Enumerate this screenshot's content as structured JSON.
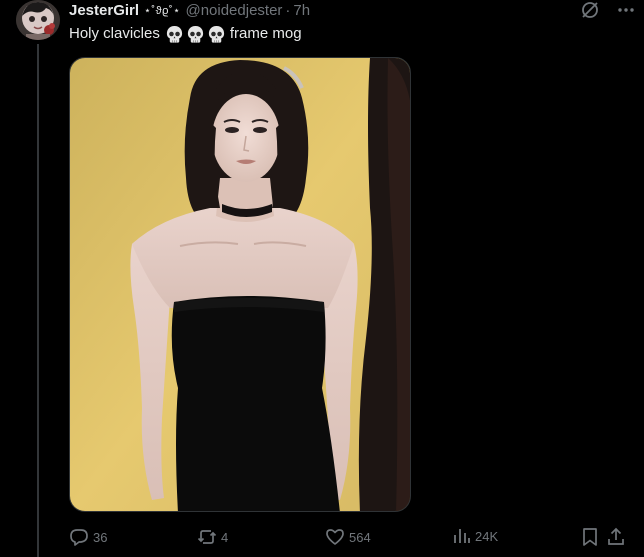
{
  "tweet": {
    "display_name": "JesterGirl",
    "name_decoration": "⋆˚ϑϱ˚⋆",
    "handle": "@noidedjester",
    "separator": "·",
    "time": "7h",
    "text_before": "Holy clavicles",
    "skull_count": 3,
    "text_after": "frame mog"
  },
  "actions": {
    "replies": "36",
    "reposts": "4",
    "likes": "564",
    "views": "24K"
  },
  "colors": {
    "background": "#000000",
    "text": "#e7e9ea",
    "muted": "#71767b",
    "thread_line": "#333639",
    "photo_wall": "#e3c56d",
    "dress": "#0b0b0b"
  },
  "icons": [
    "grok-icon",
    "more-icon",
    "reply-icon",
    "repost-icon",
    "like-icon",
    "views-icon",
    "bookmark-icon",
    "share-icon",
    "skull-emoji"
  ]
}
